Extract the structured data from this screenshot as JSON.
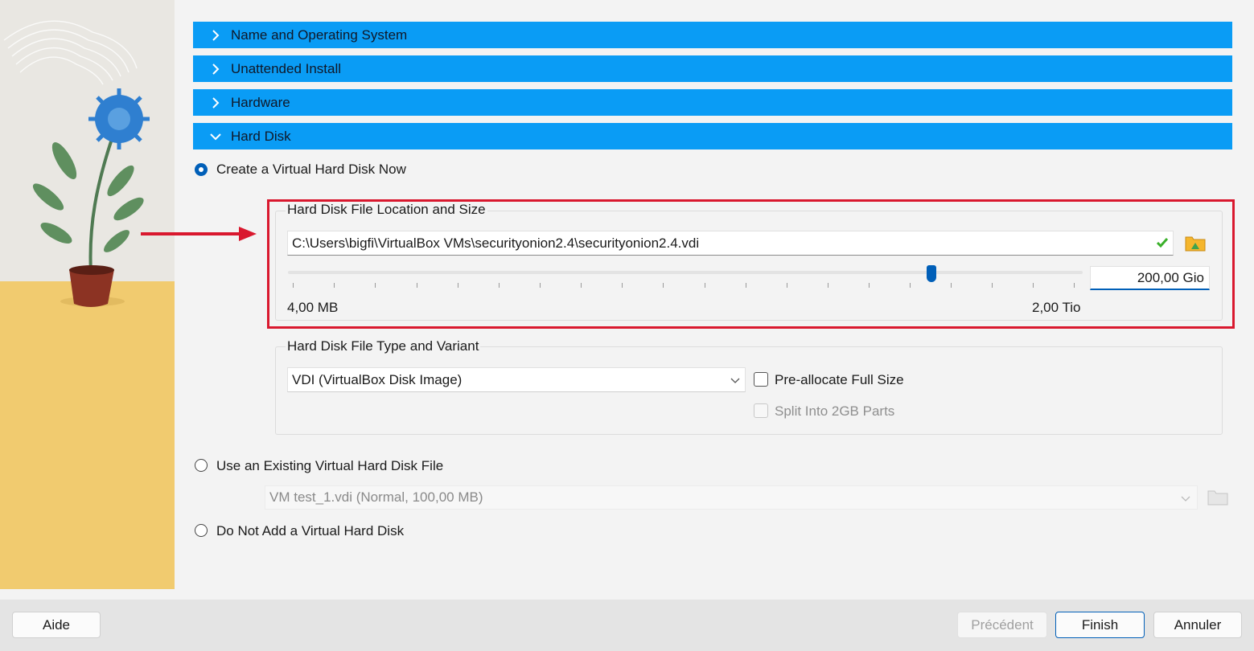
{
  "sections": [
    {
      "label": "Name and Operating System",
      "expanded": false
    },
    {
      "label": "Unattended Install",
      "expanded": false
    },
    {
      "label": "Hardware",
      "expanded": false
    },
    {
      "label": "Hard Disk",
      "expanded": true
    }
  ],
  "hard_disk": {
    "option_create": "Create a Virtual Hard Disk Now",
    "location_group_title": "Hard Disk File Location and Size",
    "file_path": "C:\\Users\\bigfi\\VirtualBox VMs\\securityonion2.4\\securityonion2.4.vdi",
    "size_value": "200,00 Gio",
    "slider_min_label": "4,00 MB",
    "slider_max_label": "2,00 Tio",
    "slider_fraction": 0.81,
    "type_group_title": "Hard Disk File Type and Variant",
    "disk_type_selected": "VDI (VirtualBox Disk Image)",
    "preallocate_label": "Pre-allocate Full Size",
    "split_label": "Split Into 2GB Parts",
    "option_existing": "Use an Existing Virtual Hard Disk File",
    "existing_selected": "VM test_1.vdi (Normal, 100,00 MB)",
    "option_none": "Do Not Add a Virtual Hard Disk"
  },
  "buttons": {
    "help": "Aide",
    "back": "Précédent",
    "finish": "Finish",
    "cancel": "Annuler"
  },
  "colors": {
    "section_header": "#0a9cf5",
    "accent": "#005fb8",
    "highlight_annotation": "#d9182e"
  },
  "icons": [
    "chevron-right-icon",
    "chevron-down-icon",
    "valid-check-icon",
    "folder-icon",
    "dropdown-arrow-icon"
  ]
}
